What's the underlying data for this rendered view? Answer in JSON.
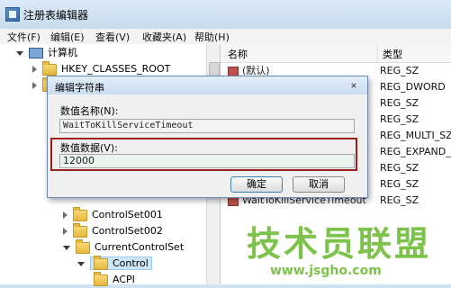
{
  "window": {
    "title": "注册表编辑器"
  },
  "menu": [
    "文件(F)",
    "编辑(E)",
    "查看(V)",
    "收藏夹(A)",
    "帮助(H)"
  ],
  "tree": {
    "root": "计算机",
    "hkcr": "HKEY_CLASSES_ROOT",
    "items": [
      "ControlSet001",
      "ControlSet002",
      "CurrentControlSet",
      "Control",
      "ACPI"
    ]
  },
  "list": {
    "headers": {
      "name": "名称",
      "type": "类型"
    },
    "rows": [
      {
        "name": "(默认)",
        "type": "REG_SZ",
        "icon": "string"
      },
      {
        "name": "",
        "type": "REG_DWORD",
        "icon": "binary"
      },
      {
        "name": "",
        "type": "REG_SZ",
        "icon": "string"
      },
      {
        "name": "",
        "type": "REG_SZ",
        "icon": "string"
      },
      {
        "name": "",
        "type": "REG_MULTI_SZ",
        "icon": "string"
      },
      {
        "name": "",
        "type": "REG_EXPAND_S",
        "icon": "string"
      },
      {
        "name": "",
        "type": "REG_SZ",
        "icon": "string"
      },
      {
        "name": "",
        "type": "REG_SZ",
        "icon": "string"
      },
      {
        "name": "WaitToKillServiceTimeout",
        "type": "REG_SZ",
        "icon": "string"
      }
    ]
  },
  "dialog": {
    "title": "编辑字符串",
    "name_label": "数值名称(N):",
    "name_value": "WaitToKillServiceTimeout",
    "data_label": "数值数据(V):",
    "data_value": "12000",
    "ok_label": "确定",
    "cancel_label": "取消",
    "close_glyph": "×"
  },
  "watermark": {
    "text": "技术员联盟",
    "url": "www.jsgho.com"
  },
  "colors": {
    "highlight": "#9d1e1e",
    "watermark": "#7dc24a"
  }
}
